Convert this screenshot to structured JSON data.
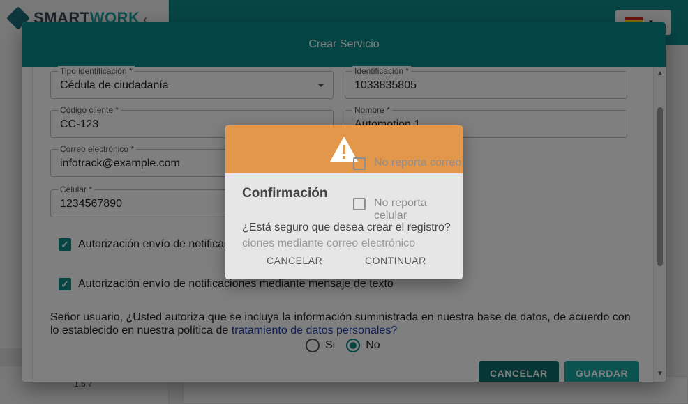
{
  "app": {
    "logo_text_main": "SMART",
    "logo_text_accent": "WORK",
    "version": "1.5.7"
  },
  "dialog": {
    "title": "Crear Servicio",
    "fields": {
      "tipo_identificacion": {
        "label": "Tipo identificación *",
        "value": "Cédula de ciudadanía"
      },
      "identificacion": {
        "label": "Identificación *",
        "value": "1033835805"
      },
      "codigo_cliente": {
        "label": "Código cliente *",
        "value": "CC-123"
      },
      "nombre": {
        "label": "Nombre *",
        "value": "Automotion 1"
      },
      "correo": {
        "label": "Correo electrónico *",
        "value": "infotrack@example.com"
      },
      "celular": {
        "label": "Celular *",
        "value": "1234567890"
      }
    },
    "no_reporta_correo": "No reporta correo",
    "no_reporta_celular": "No reporta celular",
    "auth_email": "Autorización envío de notificaciones mediante correo electrónico",
    "auth_sms": "Autorización envío de notificaciones mediante mensaje de texto",
    "consent_text": "Señor usuario, ¿Usted autoriza que se incluya la información suministrada en nuestra base de datos, de acuerdo con lo establecido en nuestra política de",
    "consent_link": "tratamiento de datos personales?",
    "radio_yes": "Si",
    "radio_no": "No",
    "cancel_label": "CANCELAR",
    "save_label": "GUARDAR"
  },
  "confirm": {
    "title": "Confirmación",
    "message": "¿Está seguro que desea crear el registro?",
    "cancel_label": "CANCELAR",
    "continue_label": "CONTINUAR"
  },
  "colors": {
    "primary": "#088d8a",
    "warning": "#e3974b"
  }
}
